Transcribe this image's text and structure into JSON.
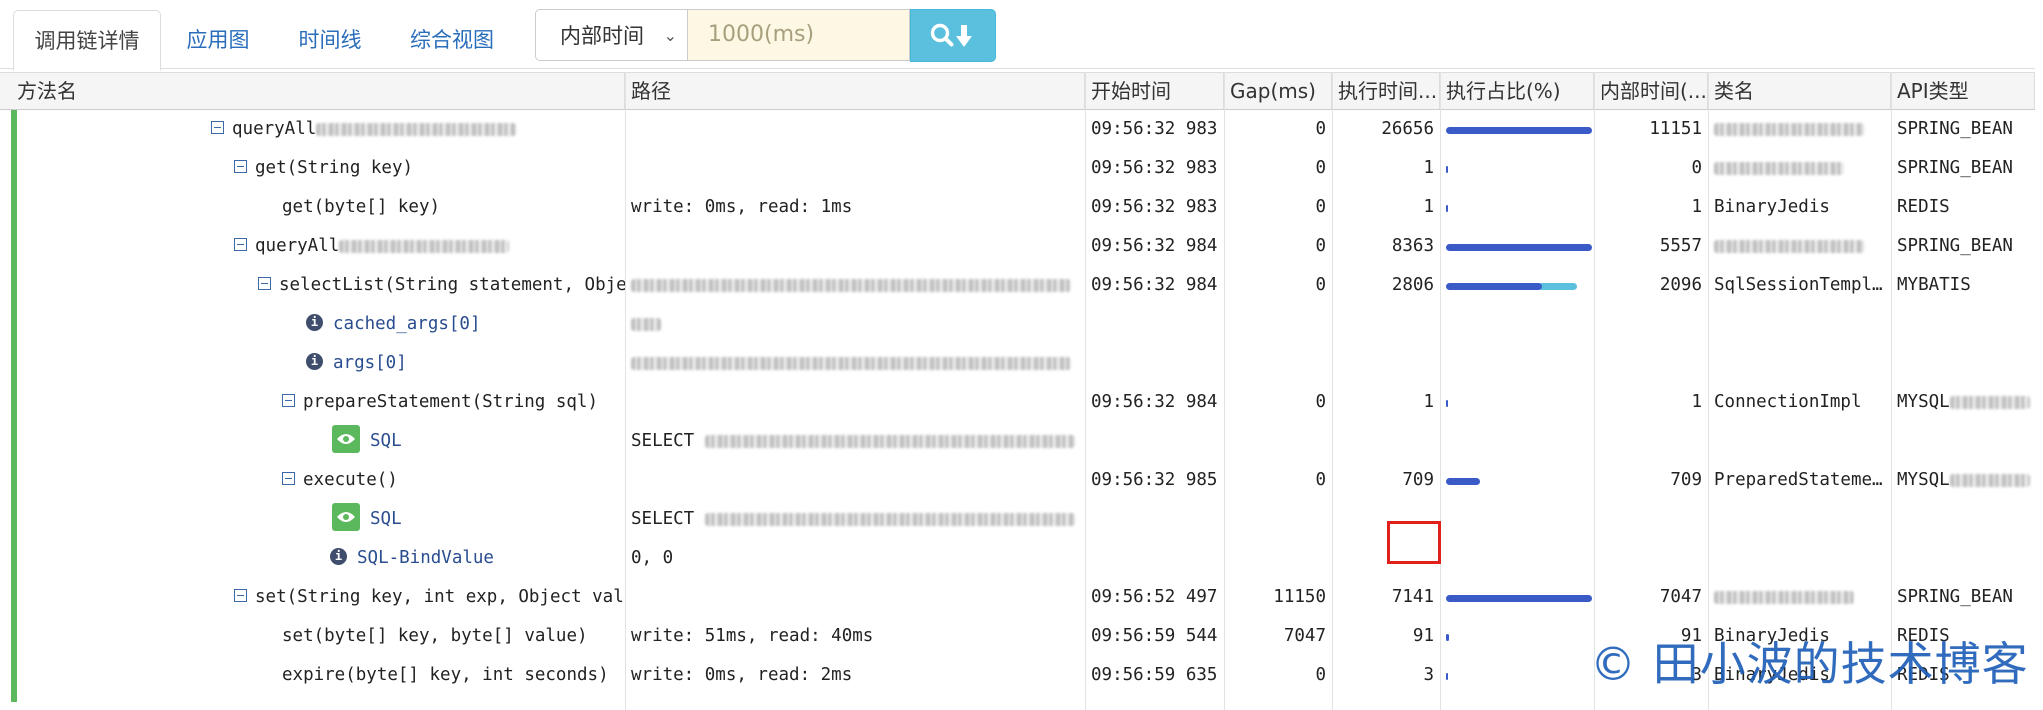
{
  "tabs": [
    {
      "label": "调用链详情",
      "active": true
    },
    {
      "label": "应用图"
    },
    {
      "label": "时间线"
    },
    {
      "label": "综合视图"
    }
  ],
  "filter": {
    "select_value": "内部时间",
    "input_placeholder": "1000(ms)"
  },
  "columns": [
    "方法名",
    "路径",
    "开始时间",
    "Gap(ms)",
    "执行时间...",
    "执行占比(%)",
    "内部时间(...",
    "类名",
    "API类型"
  ],
  "rows": [
    {
      "method": "queryAll",
      "path": "",
      "start": "09:56:32 983",
      "gap": "0",
      "exec": "26656",
      "ratio": 1.0,
      "inner": "11151",
      "class": "",
      "api": "SPRING_BEAN"
    },
    {
      "method": "get(String key)",
      "path": "",
      "start": "09:56:32 983",
      "gap": "0",
      "exec": "1",
      "ratio": 0.0,
      "inner": "0",
      "class": "",
      "api": "SPRING_BEAN"
    },
    {
      "method": "get(byte[] key)",
      "path": "write: 0ms, read: 1ms",
      "start": "09:56:32 983",
      "gap": "0",
      "exec": "1",
      "ratio": 0.0,
      "inner": "1",
      "class": "BinaryJedis",
      "api": "REDIS"
    },
    {
      "method": "queryAll",
      "path": "",
      "start": "09:56:32 984",
      "gap": "0",
      "exec": "8363",
      "ratio": 1.0,
      "inner": "5557",
      "class": "",
      "api": "SPRING_BEAN"
    },
    {
      "method": "selectList(String statement, Objec",
      "path": "",
      "start": "09:56:32 984",
      "gap": "0",
      "exec": "2806",
      "ratio": 0.9,
      "inner": "2096",
      "class": "SqlSessionTempl…",
      "api": "MYBATIS"
    },
    {
      "method": "cached_args[0]",
      "path": "",
      "start": "",
      "gap": "",
      "exec": "",
      "ratio": null,
      "inner": "",
      "class": "",
      "api": ""
    },
    {
      "method": "args[0]",
      "path": "",
      "start": "",
      "gap": "",
      "exec": "",
      "ratio": null,
      "inner": "",
      "class": "",
      "api": ""
    },
    {
      "method": "prepareStatement(String sql)",
      "path": "",
      "start": "09:56:32 984",
      "gap": "0",
      "exec": "1",
      "ratio": 0.0,
      "inner": "1",
      "class": "ConnectionImpl",
      "api": "MYSQL"
    },
    {
      "method": "SQL",
      "path": "SELECT",
      "start": "",
      "gap": "",
      "exec": "",
      "ratio": null,
      "inner": "",
      "class": "",
      "api": ""
    },
    {
      "method": "execute()",
      "path": "",
      "start": "09:56:32 985",
      "gap": "0",
      "exec": "709",
      "ratio": 0.23,
      "inner": "709",
      "class": "PreparedStateme…",
      "api": "MYSQL"
    },
    {
      "method": "SQL",
      "path": "SELECT",
      "start": "",
      "gap": "",
      "exec": "",
      "ratio": null,
      "inner": "",
      "class": "",
      "api": ""
    },
    {
      "method": "SQL-BindValue",
      "path": "0, 0",
      "start": "",
      "gap": "",
      "exec": "",
      "ratio": null,
      "inner": "",
      "class": "",
      "api": ""
    },
    {
      "method": "set(String key, int exp, Object valu",
      "path": "",
      "start": "09:56:52 497",
      "gap": "11150",
      "exec": "7141",
      "ratio": 1.0,
      "inner": "7047",
      "class": "",
      "api": "SPRING_BEAN"
    },
    {
      "method": "set(byte[] key, byte[] value)",
      "path": "write: 51ms, read: 40ms",
      "start": "09:56:59 544",
      "gap": "7047",
      "exec": "91",
      "ratio": 0.02,
      "inner": "91",
      "class": "BinaryJedis",
      "api": "REDIS"
    },
    {
      "method": "expire(byte[] key, int seconds)",
      "path": "write: 0ms, read: 2ms",
      "start": "09:56:59 635",
      "gap": "0",
      "exec": "3",
      "ratio": 0.0,
      "inner": "3",
      "class": "BinaryJedis",
      "api": "REDIS"
    }
  ],
  "watermark": "© 田小波的技术博客",
  "colors": {
    "accent": "#5cb85c",
    "bar_primary": "#3a5bc7",
    "bar_secondary": "#5bc0de",
    "highlight": "#e0201b"
  }
}
